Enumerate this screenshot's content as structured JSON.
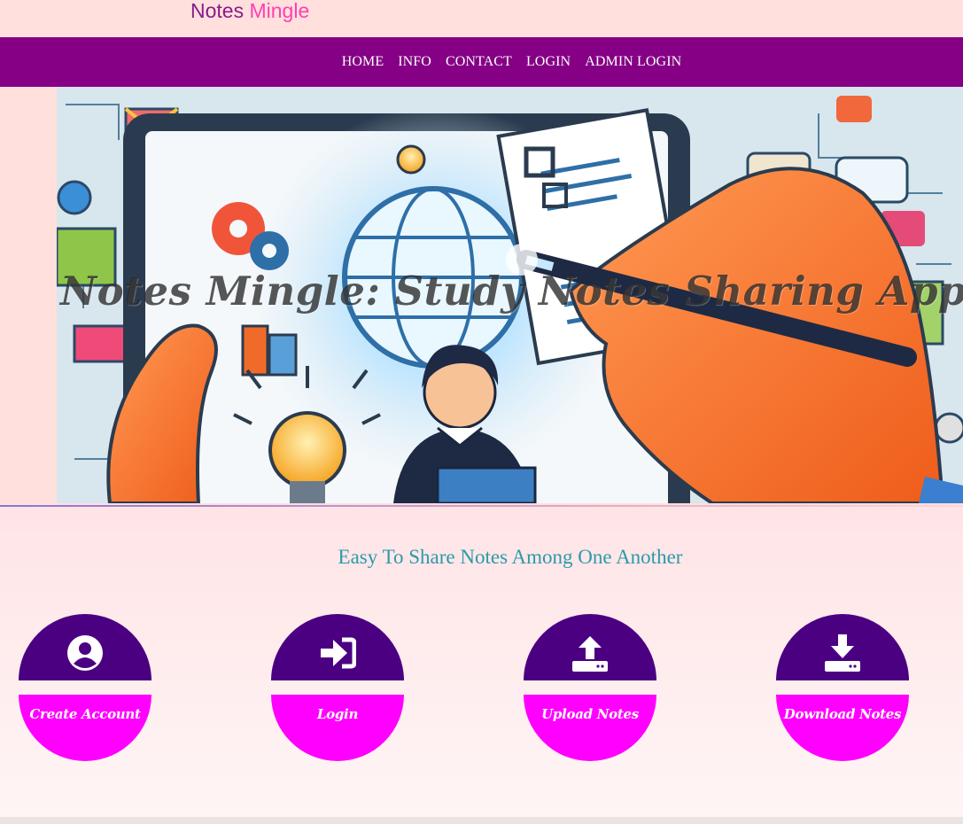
{
  "brand": {
    "part1": "Notes",
    "part2": "Mingle"
  },
  "nav": {
    "items": [
      {
        "label": "HOME"
      },
      {
        "label": "INFO"
      },
      {
        "label": "CONTACT"
      },
      {
        "label": "LOGIN"
      },
      {
        "label": "ADMIN LOGIN"
      }
    ]
  },
  "hero": {
    "title": "Notes Mingle: Study Notes Sharing Application"
  },
  "tagline": "Easy To Share Notes Among One Another",
  "features": [
    {
      "label": "Create Account",
      "icon": "user-circle-icon"
    },
    {
      "label": "Login",
      "icon": "sign-in-icon"
    },
    {
      "label": "Upload Notes",
      "icon": "upload-icon"
    },
    {
      "label": "Download Notes",
      "icon": "download-icon"
    }
  ],
  "colors": {
    "page_bg": "#ffe0dc",
    "navbar": "#850085",
    "brand_dark": "#8b1a8b",
    "brand_pink": "#ff3eb2",
    "circle_top": "#4b0082",
    "circle_bottom": "#ff00ff",
    "tagline": "#2b9aaa"
  }
}
